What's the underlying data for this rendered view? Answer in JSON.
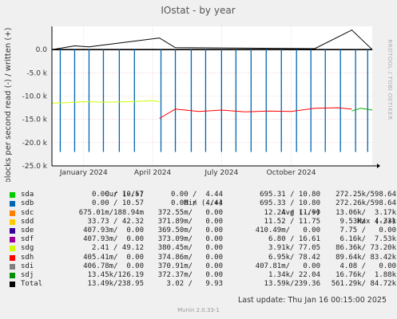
{
  "chart_data": {
    "type": "line",
    "title": "IOstat - by year",
    "ylabel": "blocks per second read (-) / written (+)",
    "side_label": "RRDTOOL / TOBI OETIKER",
    "ylim": [
      -25000,
      5000
    ],
    "yticks": [
      {
        "v": 0,
        "label": "0.0"
      },
      {
        "v": -5000,
        "label": "-5.0 k"
      },
      {
        "v": -10000,
        "label": "-10.0 k"
      },
      {
        "v": -15000,
        "label": "-15.0 k"
      },
      {
        "v": -20000,
        "label": "-20.0 k"
      },
      {
        "v": -25000,
        "label": "-25.0 k"
      }
    ],
    "xrange": [
      "2023-11-20",
      "2025-01-16"
    ],
    "xticks": [
      {
        "date": "2024-01-01",
        "label": "January 2024"
      },
      {
        "date": "2024-04-01",
        "label": "April 2024"
      },
      {
        "date": "2024-07-01",
        "label": "July 2024"
      },
      {
        "date": "2024-10-01",
        "label": "October 2024"
      }
    ],
    "read_spikes": {
      "dates": [
        "2023-12-01",
        "2023-12-20",
        "2024-01-08",
        "2024-01-27",
        "2024-02-17",
        "2024-03-08",
        "2024-04-12",
        "2024-05-01",
        "2024-05-22",
        "2024-06-10",
        "2024-07-01",
        "2024-07-20",
        "2024-08-09",
        "2024-08-29",
        "2024-09-18",
        "2024-10-08",
        "2024-10-27",
        "2024-11-15",
        "2024-12-05",
        "2024-12-25",
        "2025-01-10"
      ],
      "value": -22000
    },
    "series": [
      {
        "name": "sdg",
        "color": "#ccff00",
        "x": [
          "2023-11-20",
          "2023-12-10",
          "2024-01-01",
          "2024-02-01",
          "2024-03-01",
          "2024-04-01",
          "2024-04-10"
        ],
        "y": [
          -11500,
          -11400,
          -11200,
          -11300,
          -11200,
          -11000,
          -11200
        ]
      },
      {
        "name": "sdh",
        "color": "#ff0000",
        "x": [
          "2024-04-10",
          "2024-05-01",
          "2024-06-01",
          "2024-07-01",
          "2024-08-01",
          "2024-09-01",
          "2024-10-01",
          "2024-11-01",
          "2024-12-01",
          "2024-12-20"
        ],
        "y": [
          -14800,
          -12800,
          -13300,
          -13000,
          -13400,
          -13200,
          -13300,
          -12600,
          -12500,
          -12800
        ]
      },
      {
        "name": "sdj",
        "color": "#00aa00",
        "x": [
          "2024-12-20",
          "2025-01-01",
          "2025-01-16"
        ],
        "y": [
          -13200,
          -12600,
          -13000
        ]
      },
      {
        "name": "Total",
        "color": "#000000",
        "x": [
          "2023-11-20",
          "2023-12-20",
          "2024-01-08",
          "2024-04-10",
          "2024-05-01",
          "2024-11-01",
          "2024-12-20",
          "2025-01-16"
        ],
        "y": [
          0,
          800,
          600,
          2500,
          400,
          200,
          4200,
          0
        ]
      }
    ]
  },
  "legend": {
    "headers": [
      "Cur (-/+)",
      "Min (-/+)",
      "Avg (-/+)",
      "Max (-/+)"
    ],
    "rows": [
      {
        "name": "sda",
        "color": "#00cc00",
        "cur": "0.00 / 10.57",
        "min": "0.00 /  4.44",
        "avg": "695.31 / 10.80",
        "max": "272.25k/598.64"
      },
      {
        "name": "sdb",
        "color": "#0066b3",
        "cur": "0.00 / 10.57",
        "min": "0.00 /  4.44",
        "avg": "695.33 / 10.80",
        "max": "272.26k/598.64"
      },
      {
        "name": "sdc",
        "color": "#ff8000",
        "cur": "675.01m/188.94m",
        "min": "372.55m/   0.00",
        "avg": "12.24 / 11.90",
        "max": "13.06k/  3.17k"
      },
      {
        "name": "sdd",
        "color": "#ffcc00",
        "cur": "33.73 / 42.32",
        "min": "371.89m/   0.00",
        "avg": "11.52 / 11.75",
        "max": "9.53k/  4.33k"
      },
      {
        "name": "sde",
        "color": "#330099",
        "cur": "407.93m/  0.00",
        "min": "369.50m/   0.00",
        "avg": "410.49m/   0.00",
        "max": "7.75 /   0.00"
      },
      {
        "name": "sdf",
        "color": "#990099",
        "cur": "407.93m/  0.00",
        "min": "373.09m/   0.00",
        "avg": "6.80 / 16.61",
        "max": "6.16k/  7.53k"
      },
      {
        "name": "sdg",
        "color": "#ccff00",
        "cur": "2.41 / 49.12",
        "min": "380.45m/   0.00",
        "avg": "3.91k/ 77.05",
        "max": "86.36k/ 73.20k"
      },
      {
        "name": "sdh",
        "color": "#ff0000",
        "cur": "405.41m/  0.00",
        "min": "374.86m/   0.00",
        "avg": "6.95k/ 78.42",
        "max": "89.64k/ 83.42k"
      },
      {
        "name": "sdi",
        "color": "#808080",
        "cur": "406.78m/  0.00",
        "min": "370.91m/   0.00",
        "avg": "407.81m/   0.00",
        "max": "4.08 /   0.00"
      },
      {
        "name": "sdj",
        "color": "#008f00",
        "cur": "13.45k/126.19",
        "min": "372.37m/   0.00",
        "avg": "1.34k/ 22.04",
        "max": "16.76k/  1.88k"
      },
      {
        "name": "Total",
        "color": "#000000",
        "cur": "13.49k/238.95",
        "min": "3.02 /   9.93",
        "avg": "13.59k/239.36",
        "max": "561.29k/ 84.72k"
      }
    ]
  },
  "last_update": "Last update:  Thu Jan 16 00:15:00 2025",
  "version": "Munin 2.0.33-1"
}
